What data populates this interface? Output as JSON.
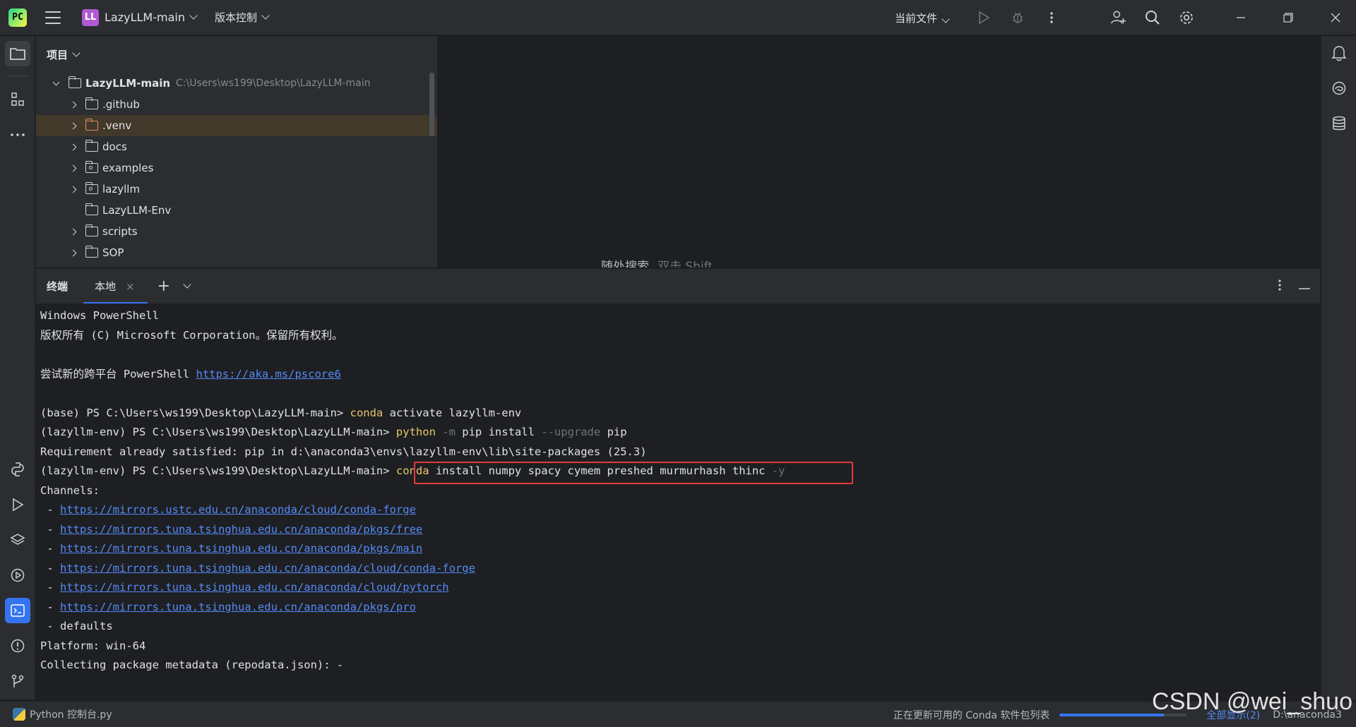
{
  "titlebar": {
    "project_badge": "LL",
    "project_name": "LazyLLM-main",
    "vcs_label": "版本控制",
    "run_config": "当前文件"
  },
  "project_panel": {
    "title": "项目",
    "root": {
      "name": "LazyLLM-main",
      "path": "C:\\Users\\ws199\\Desktop\\LazyLLM-main"
    },
    "items": [
      {
        "name": ".github"
      },
      {
        "name": ".venv"
      },
      {
        "name": "docs"
      },
      {
        "name": "examples"
      },
      {
        "name": "lazyllm"
      },
      {
        "name": "LazyLLM-Env"
      },
      {
        "name": "scripts"
      },
      {
        "name": "SOP"
      }
    ]
  },
  "editor": {
    "hint_action": "随处搜索",
    "hint_key": "双击 Shift"
  },
  "terminal": {
    "title": "终端",
    "tab_label": "本地",
    "lines": {
      "l1": "Windows PowerShell",
      "l2": "版权所有 (C) Microsoft Corporation。保留所有权利。",
      "l4_prefix": "尝试新的跨平台 PowerShell ",
      "l4_link": "https://aka.ms/pscore6",
      "l6_prompt": "(base) PS C:\\Users\\ws199\\Desktop\\LazyLLM-main> ",
      "l6_cmd": "conda",
      "l6_rest": " activate lazyllm-env",
      "l7_prompt": "(lazyllm-env) PS C:\\Users\\ws199\\Desktop\\LazyLLM-main> ",
      "l7_cmd": "python",
      "l7_f1": " -m",
      "l7_mid": " pip install",
      "l7_f2": " --upgrade",
      "l7_rest": " pip",
      "l8": "Requirement already satisfied: pip in d:\\anaconda3\\envs\\lazyllm-env\\lib\\site-packages (25.3)",
      "l9_prompt": "(lazyllm-env) PS C:\\Users\\ws199\\Desktop\\LazyLLM-main> ",
      "l9_cmd": "conda",
      "l9_rest": " install numpy spacy cymem preshed murmurhash thinc",
      "l9_flag": " -y",
      "l10": "Channels:",
      "channels": [
        "https://mirrors.ustc.edu.cn/anaconda/cloud/conda-forge",
        "https://mirrors.tuna.tsinghua.edu.cn/anaconda/pkgs/free",
        "https://mirrors.tuna.tsinghua.edu.cn/anaconda/pkgs/main",
        "https://mirrors.tuna.tsinghua.edu.cn/anaconda/cloud/conda-forge",
        "https://mirrors.tuna.tsinghua.edu.cn/anaconda/cloud/pytorch",
        "https://mirrors.tuna.tsinghua.edu.cn/anaconda/pkgs/pro"
      ],
      "defaults": " - defaults",
      "platform": "Platform: win-64",
      "collecting": "Collecting package metadata (repodata.json): -"
    }
  },
  "statusbar": {
    "left": "Python 控制台.py",
    "task": "正在更新可用的 Conda 软件包列表",
    "progress_percent": 82,
    "show_all": "全部显示(2)",
    "interpreter": "D:\\anaconda3"
  },
  "watermark": "CSDN @wei_shuo",
  "colors": {
    "accent": "#3574f0",
    "highlight_box": "#e03c3c",
    "command": "#e8c46e",
    "link": "#548af7"
  }
}
